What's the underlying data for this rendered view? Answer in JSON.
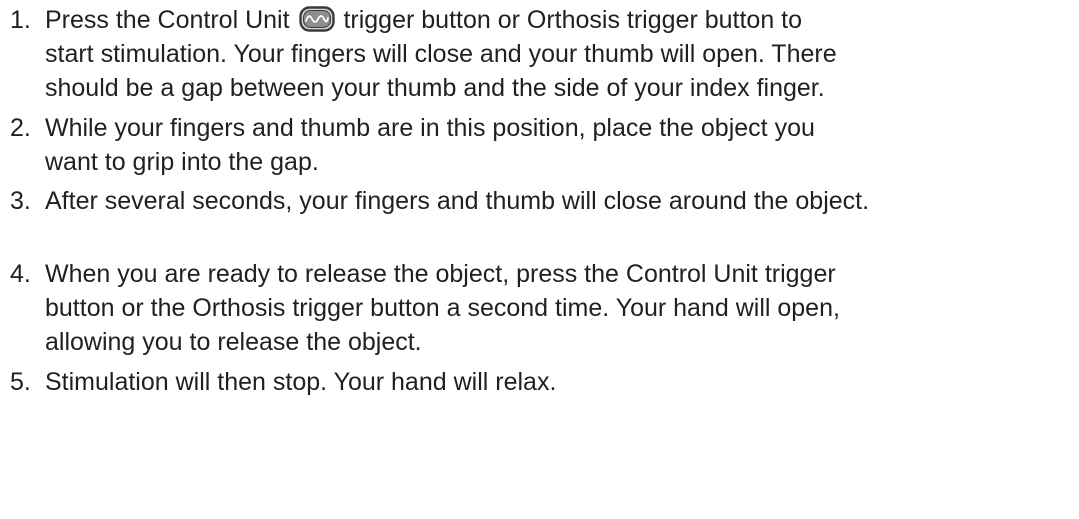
{
  "steps": [
    {
      "number": "1.",
      "line1_before_icon": "Press the Control Unit",
      "line1_after_icon": "trigger button or Orthosis trigger button to",
      "line2": "start stimulation. Your fingers will close and your thumb will open. There",
      "line3": "should be a gap between your thumb and the side of your index finger.",
      "icon": "control-unit-trigger-icon"
    },
    {
      "number": "2.",
      "line1": "While your fingers and thumb are in this position, place the object you",
      "line2": "want to grip into the gap."
    },
    {
      "number": "3.",
      "line1": "After several seconds, your fingers and thumb will close around the object."
    },
    {
      "number": "4.",
      "line1": "When you are ready to release the object, press the Control Unit trigger",
      "line2": "button or the Orthosis trigger button a second time. Your hand will open,",
      "line3": "allowing you to release the object."
    },
    {
      "number": "5.",
      "line1": "Stimulation will then stop. Your hand will relax."
    }
  ],
  "colors": {
    "text": "#231f20",
    "icon_fill": "#d9d9d9",
    "icon_stroke": "#3a3a3a"
  }
}
